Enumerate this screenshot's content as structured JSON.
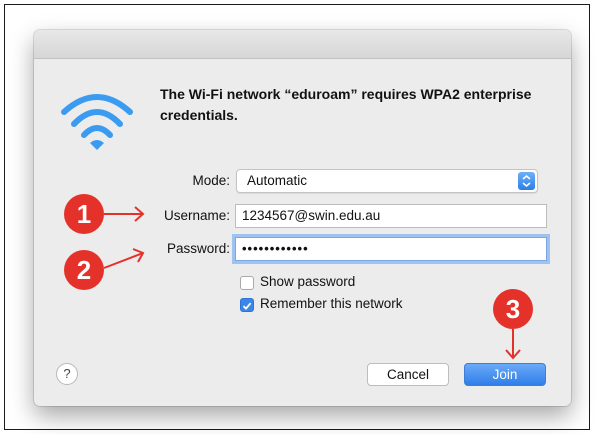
{
  "dialog": {
    "message": "The Wi-Fi network “eduroam” requires WPA2 enterprise credentials.",
    "mode_label": "Mode:",
    "mode_value": "Automatic",
    "username_label": "Username:",
    "username_value": "1234567@swin.edu.au",
    "password_label": "Password:",
    "password_masked": "••••••••••••",
    "show_password_label": "Show password",
    "show_password_checked": false,
    "remember_label": "Remember this network",
    "remember_checked": true,
    "help_label": "?",
    "cancel_label": "Cancel",
    "join_label": "Join"
  },
  "annotations": {
    "step1": "1",
    "step2": "2",
    "step3": "3",
    "badge_color": "#e4322b"
  },
  "colors": {
    "accent": "#3b86e8",
    "wifi": "#3b9bf0"
  },
  "icons": {
    "network": "wifi-icon",
    "popup": "chevron-updown-icon",
    "checkbox": "checkmark-icon"
  }
}
